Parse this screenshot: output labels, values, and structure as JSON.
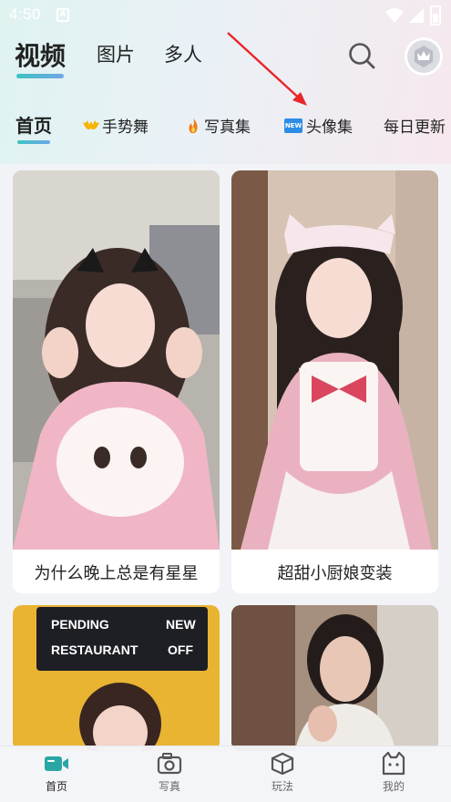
{
  "status_bar": {
    "time": "4:50",
    "notification_glyph": "A"
  },
  "header": {
    "tabs": [
      {
        "label": "视频",
        "active": true
      },
      {
        "label": "图片",
        "active": false
      },
      {
        "label": "多人",
        "active": false
      }
    ],
    "icons": [
      "search-icon",
      "crown-icon"
    ]
  },
  "categories": [
    {
      "label": "首页",
      "active": true
    },
    {
      "label": "手势舞",
      "icon": "hands-icon"
    },
    {
      "label": "写真集",
      "icon": "fire-icon"
    },
    {
      "label": "头像集",
      "icon": "new-badge-icon",
      "badge": "NEW"
    },
    {
      "label": "每日更新"
    }
  ],
  "cards": [
    {
      "caption": "为什么晚上总是有星星"
    },
    {
      "caption": "超甜小厨娘变装"
    },
    {
      "caption": "",
      "sign_line1": "PENDING",
      "sign_line1b": "NEW",
      "sign_line2": "RESTAURANT",
      "sign_line2b": "OFF"
    },
    {
      "caption": ""
    }
  ],
  "bottom_nav": [
    {
      "label": "首页",
      "icon": "video-camera-icon",
      "active": true
    },
    {
      "label": "写真",
      "icon": "camera-icon"
    },
    {
      "label": "玩法",
      "icon": "cube-icon"
    },
    {
      "label": "我的",
      "icon": "cat-face-icon"
    }
  ],
  "colors": {
    "accent_start": "#3cc3c0",
    "accent_end": "#6fa6e8",
    "annotation_arrow": "#e8262a",
    "new_badge": "#2d8ce6"
  }
}
